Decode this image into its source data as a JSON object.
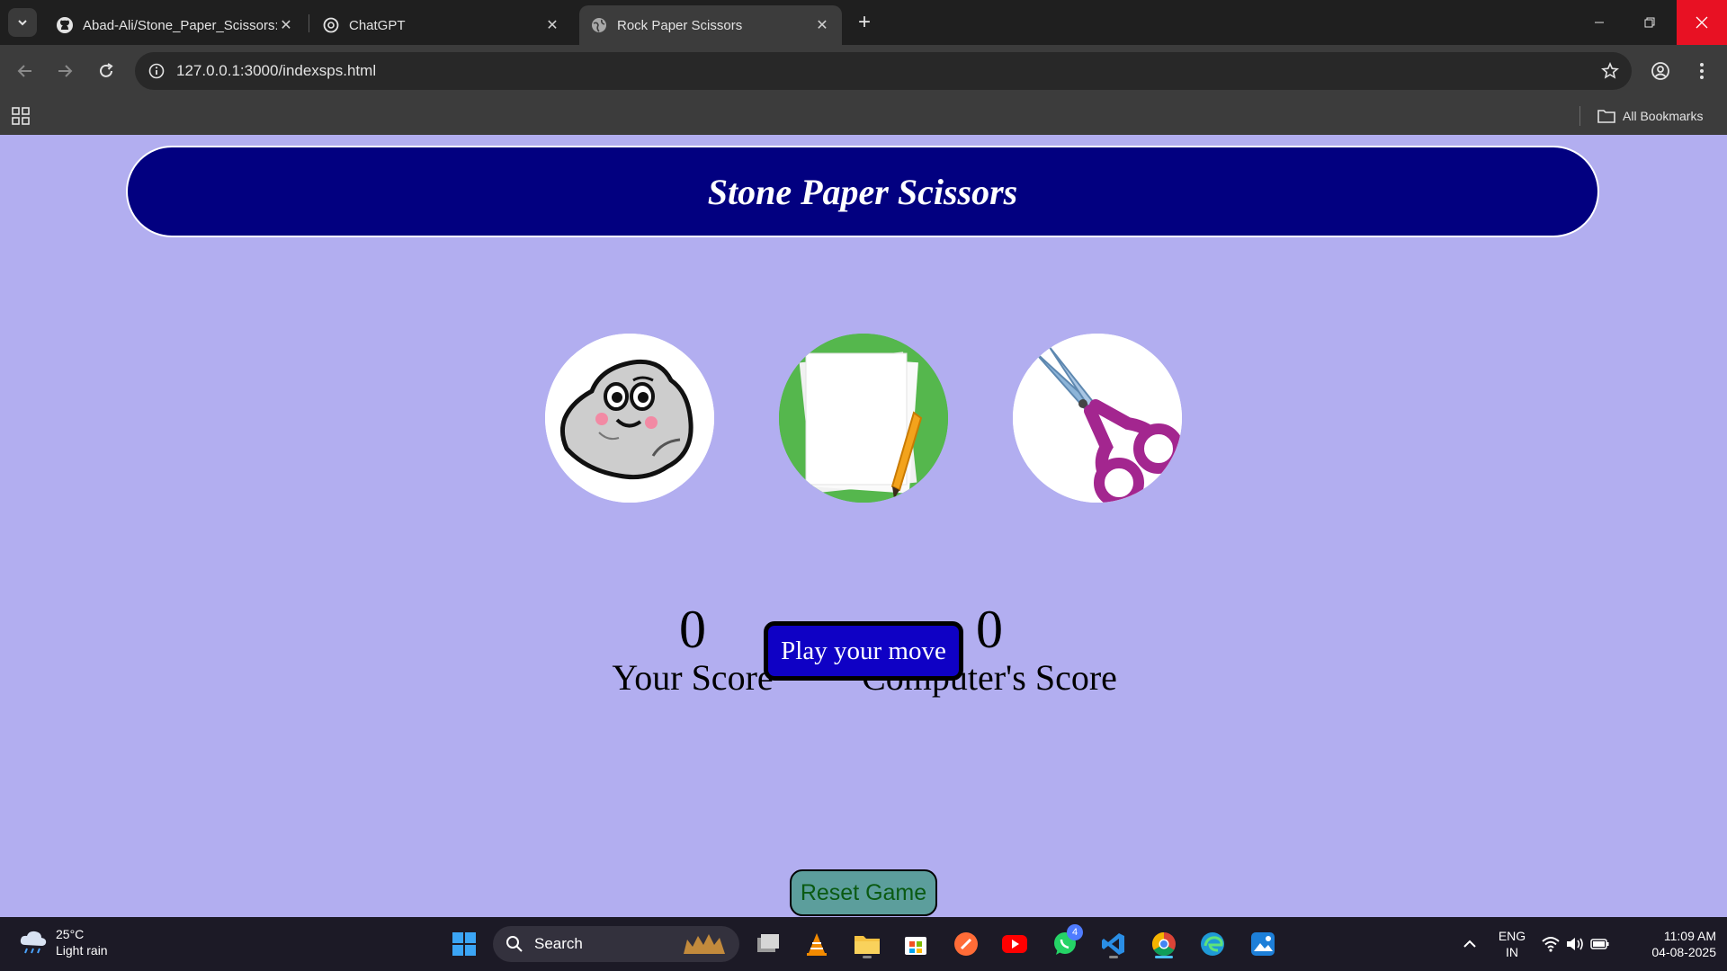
{
  "browser": {
    "tabs": [
      {
        "label": "Abad-Ali/Stone_Paper_Scissors:",
        "icon": "github-icon",
        "active": false
      },
      {
        "label": "ChatGPT",
        "icon": "chatgpt-icon",
        "active": false
      },
      {
        "label": "Rock Paper Scissors",
        "icon": "globe-icon",
        "active": true
      }
    ],
    "url": "127.0.0.1:3000/indexsps.html",
    "bookmarks_label": "All Bookmarks"
  },
  "game": {
    "title": "Stone Paper Scissors",
    "choices": [
      {
        "id": "rock",
        "icon": "rock-icon"
      },
      {
        "id": "paper",
        "icon": "paper-icon"
      },
      {
        "id": "scissors",
        "icon": "scissors-icon"
      }
    ],
    "user_score": "0",
    "user_score_label": "Your Score",
    "comp_score": "0",
    "comp_score_label": "Computer's Score",
    "play_button": "Play your move",
    "reset_button": "Reset Game"
  },
  "taskbar": {
    "weather_temp": "25°C",
    "weather_desc": "Light rain",
    "search_label": "Search",
    "whatsapp_badge": "4",
    "lang_top": "ENG",
    "lang_bottom": "IN",
    "time": "11:09 AM",
    "date": "04-08-2025"
  },
  "colors": {
    "page_bg": "#b2aef0",
    "title_bg": "#020080",
    "play_bg": "#0f01c5",
    "reset_bg": "#5c9e9c",
    "reset_text": "#0a5a12"
  }
}
